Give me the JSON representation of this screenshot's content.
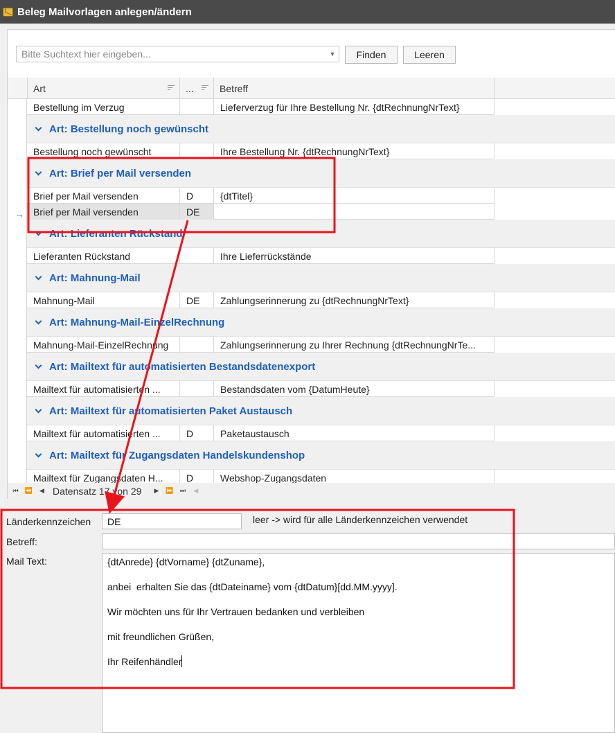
{
  "window": {
    "title": "Beleg Mailvorlagen anlegen/ändern"
  },
  "search": {
    "placeholder": "Bitte Suchtext hier eingeben...",
    "find_label": "Finden",
    "clear_label": "Leeren"
  },
  "grid": {
    "columns": {
      "art": "Art",
      "lang": "...",
      "subject": "Betreff"
    },
    "rows": [
      {
        "type": "row",
        "art": "Bestellung im Verzug",
        "lang": "",
        "subject": "Lieferverzug für Ihre Bestellung Nr. {dtRechnungNrText}"
      },
      {
        "type": "group",
        "label": "Art: Bestellung noch gewünscht"
      },
      {
        "type": "row",
        "art": "Bestellung noch gewünscht",
        "lang": "",
        "subject": "Ihre Bestellung Nr. {dtRechnungNrText}"
      },
      {
        "type": "group",
        "label": "Art: Brief per Mail versenden"
      },
      {
        "type": "row",
        "art": "Brief per Mail versenden",
        "lang": "D",
        "subject": "{dtTitel}"
      },
      {
        "type": "row",
        "art": "Brief per Mail versenden",
        "lang": "DE",
        "subject": "",
        "selected": true
      },
      {
        "type": "group",
        "label": "Art: Lieferanten Rückstand"
      },
      {
        "type": "row",
        "art": "Lieferanten Rückstand",
        "lang": "",
        "subject": "Ihre Lieferrückstände"
      },
      {
        "type": "group",
        "label": "Art: Mahnung-Mail"
      },
      {
        "type": "row",
        "art": "Mahnung-Mail",
        "lang": "DE",
        "subject": "Zahlungserinnerung zu {dtRechnungNrText}"
      },
      {
        "type": "group",
        "label": "Art: Mahnung-Mail-EinzelRechnung"
      },
      {
        "type": "row",
        "art": "Mahnung-Mail-EinzelRechnung",
        "lang": "",
        "subject": "Zahlungserinnerung zu Ihrer Rechnung {dtRechnungNrTe..."
      },
      {
        "type": "group",
        "label": "Art: Mailtext für automatisierten Bestandsdatenexport"
      },
      {
        "type": "row",
        "art": "Mailtext für automatisierten ...",
        "lang": "",
        "subject": "Bestandsdaten vom {DatumHeute}"
      },
      {
        "type": "group",
        "label": "Art: Mailtext für automatisierten Paket Austausch"
      },
      {
        "type": "row",
        "art": "Mailtext für automatisierten ...",
        "lang": "D",
        "subject": "Paketaustausch"
      },
      {
        "type": "group",
        "label": "Art: Mailtext für Zugangsdaten Handelskundenshop"
      },
      {
        "type": "row",
        "art": "Mailtext für Zugangsdaten H...",
        "lang": "D",
        "subject": "Webshop-Zugangsdaten"
      }
    ],
    "navigator": {
      "label": "Datensatz 17 von 29"
    }
  },
  "form": {
    "country_label": "Länderkennzeichen",
    "country_value": "DE",
    "country_hint": "leer -> wird für alle Länderkennzeichen verwendet",
    "subject_label": "Betreff:",
    "subject_value": "",
    "mailtext_label": "Mail Text:",
    "mailtext_lines": [
      "{dtAnrede} {dtVorname} {dtZuname},",
      "anbei  erhalten Sie das {dtDateiname} vom {dtDatum}[dd.MM.yyyy].",
      "Wir möchten uns für Ihr Vertrauen bedanken und verbleiben",
      "mit freundlichen Grüßen,",
      "Ihr Reifenhändler"
    ]
  },
  "colors": {
    "titlebar": "#4a4a4a",
    "group_text": "#1f5fbf",
    "annotation": "#e8141c"
  }
}
